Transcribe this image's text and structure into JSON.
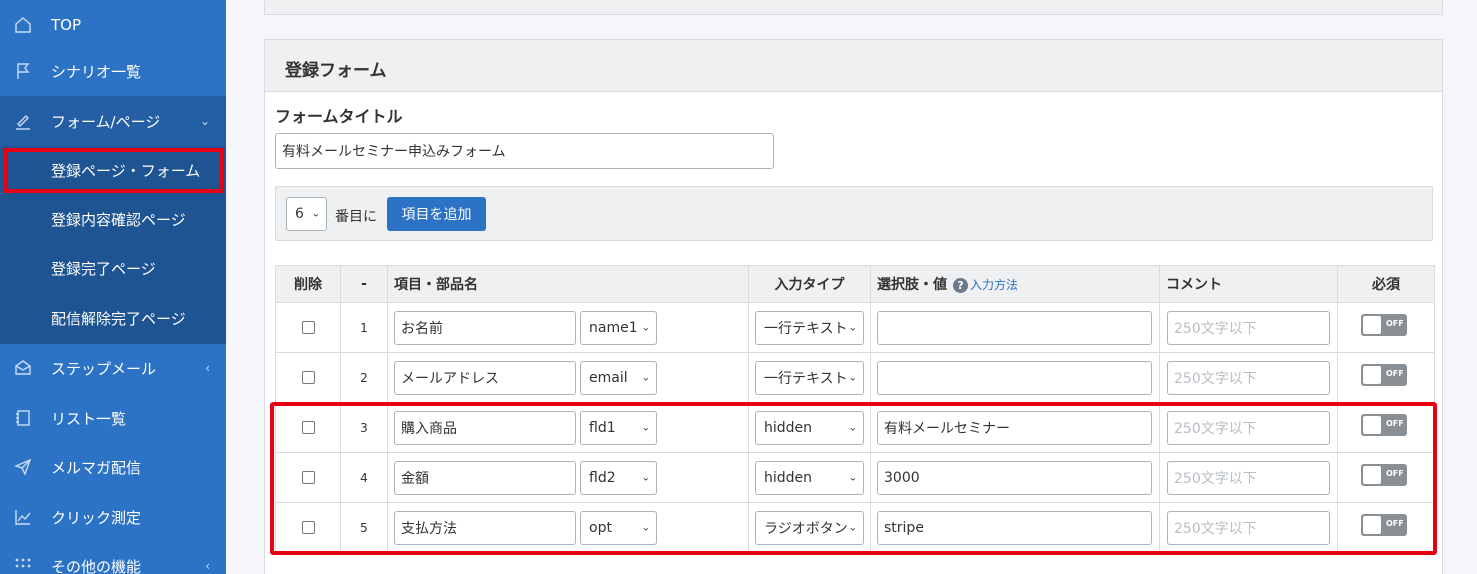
{
  "sidebar": {
    "items": [
      {
        "label": "TOP",
        "icon": "home-icon"
      },
      {
        "label": "シナリオ一覧",
        "icon": "flag-icon"
      },
      {
        "label": "フォーム/ページ",
        "icon": "pen-icon",
        "chevron": "⌄"
      },
      {
        "label": "ステップメール",
        "icon": "mail-icon",
        "chevron": "‹"
      },
      {
        "label": "リスト一覧",
        "icon": "list-icon"
      },
      {
        "label": "メルマガ配信",
        "icon": "send-icon"
      },
      {
        "label": "クリック測定",
        "icon": "chart-icon"
      },
      {
        "label": "その他の機能",
        "icon": "grid-icon",
        "chevron": "‹"
      }
    ],
    "subitems": [
      {
        "label": "登録ページ・フォーム"
      },
      {
        "label": "登録内容確認ページ"
      },
      {
        "label": "登録完了ページ"
      },
      {
        "label": "配信解除完了ページ"
      }
    ]
  },
  "card": {
    "title": "登録フォーム",
    "form_title_label": "フォームタイトル",
    "form_title_value": "有料メールセミナー申込みフォーム",
    "add_position": "6",
    "add_position_suffix": "番目に",
    "add_button": "項目を追加"
  },
  "table": {
    "headers": {
      "delete": "削除",
      "num": "-",
      "item": "項目・部品名",
      "type": "入力タイプ",
      "choices": "選択肢・値",
      "help_link": "入力方法",
      "comment": "コメント",
      "required": "必須"
    },
    "rows": [
      {
        "num": "1",
        "name": "お名前",
        "key": "name1",
        "type": "一行テキスト",
        "value": "",
        "comment_placeholder": "250文字以下",
        "required": "OFF"
      },
      {
        "num": "2",
        "name": "メールアドレス",
        "key": "email",
        "type": "一行テキスト",
        "value": "",
        "comment_placeholder": "250文字以下",
        "required": "OFF"
      },
      {
        "num": "3",
        "name": "購入商品",
        "key": "fld1",
        "type": "hidden",
        "value": "有料メールセミナー",
        "comment_placeholder": "250文字以下",
        "required": "OFF"
      },
      {
        "num": "4",
        "name": "金額",
        "key": "fld2",
        "type": "hidden",
        "value": "3000",
        "comment_placeholder": "250文字以下",
        "required": "OFF"
      },
      {
        "num": "5",
        "name": "支払方法",
        "key": "opt",
        "type": "ラジオボタン",
        "value": "stripe",
        "comment_placeholder": "250文字以下",
        "required": "OFF"
      }
    ]
  },
  "colors": {
    "sidebar": "#2c73c5",
    "sidebar_sub": "#1f5492",
    "accent": "#2c73c5",
    "highlight": "#e60012"
  }
}
